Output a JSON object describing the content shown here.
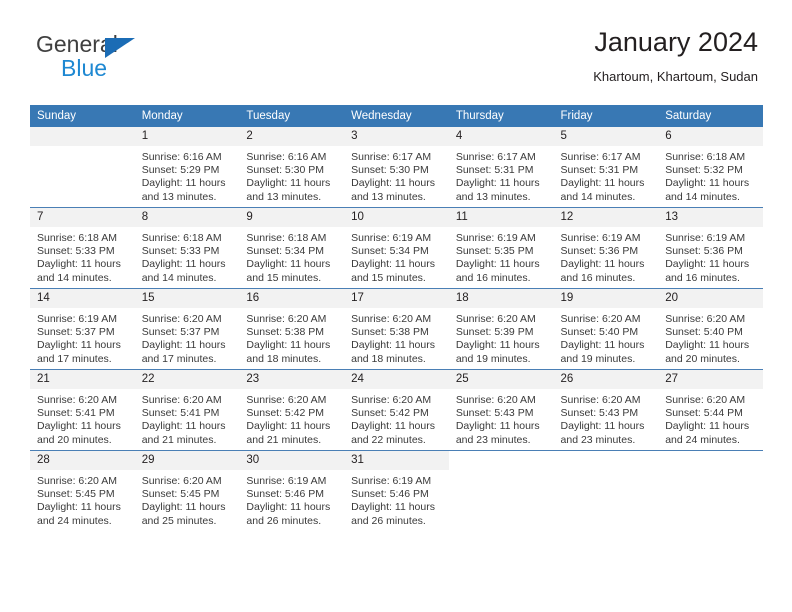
{
  "brand": {
    "name_top": "General",
    "name_bottom": "Blue",
    "triangle_color": "#1b6cb5",
    "blue_text_color": "#1e88d2"
  },
  "header": {
    "title": "January 2024",
    "location": "Khartoum, Khartoum, Sudan"
  },
  "theme": {
    "header_bar": "#3878b4",
    "daynum_band": "#f2f2f2",
    "row_divider": "#4a7fb5",
    "text": "#231f20"
  },
  "weekday_headers": [
    "Sunday",
    "Monday",
    "Tuesday",
    "Wednesday",
    "Thursday",
    "Friday",
    "Saturday"
  ],
  "labels": {
    "sunrise_prefix": "Sunrise:",
    "sunset_prefix": "Sunset:",
    "daylight_prefix": "Daylight:"
  },
  "weeks": [
    [
      {
        "day": "",
        "empty": true,
        "sunrise": "",
        "sunset": "",
        "daylight_line1": "",
        "daylight_line2": ""
      },
      {
        "day": "1",
        "sunrise": "Sunrise: 6:16 AM",
        "sunset": "Sunset: 5:29 PM",
        "daylight_line1": "Daylight: 11 hours",
        "daylight_line2": "and 13 minutes."
      },
      {
        "day": "2",
        "sunrise": "Sunrise: 6:16 AM",
        "sunset": "Sunset: 5:30 PM",
        "daylight_line1": "Daylight: 11 hours",
        "daylight_line2": "and 13 minutes."
      },
      {
        "day": "3",
        "sunrise": "Sunrise: 6:17 AM",
        "sunset": "Sunset: 5:30 PM",
        "daylight_line1": "Daylight: 11 hours",
        "daylight_line2": "and 13 minutes."
      },
      {
        "day": "4",
        "sunrise": "Sunrise: 6:17 AM",
        "sunset": "Sunset: 5:31 PM",
        "daylight_line1": "Daylight: 11 hours",
        "daylight_line2": "and 13 minutes."
      },
      {
        "day": "5",
        "sunrise": "Sunrise: 6:17 AM",
        "sunset": "Sunset: 5:31 PM",
        "daylight_line1": "Daylight: 11 hours",
        "daylight_line2": "and 14 minutes."
      },
      {
        "day": "6",
        "sunrise": "Sunrise: 6:18 AM",
        "sunset": "Sunset: 5:32 PM",
        "daylight_line1": "Daylight: 11 hours",
        "daylight_line2": "and 14 minutes."
      }
    ],
    [
      {
        "day": "7",
        "sunrise": "Sunrise: 6:18 AM",
        "sunset": "Sunset: 5:33 PM",
        "daylight_line1": "Daylight: 11 hours",
        "daylight_line2": "and 14 minutes."
      },
      {
        "day": "8",
        "sunrise": "Sunrise: 6:18 AM",
        "sunset": "Sunset: 5:33 PM",
        "daylight_line1": "Daylight: 11 hours",
        "daylight_line2": "and 14 minutes."
      },
      {
        "day": "9",
        "sunrise": "Sunrise: 6:18 AM",
        "sunset": "Sunset: 5:34 PM",
        "daylight_line1": "Daylight: 11 hours",
        "daylight_line2": "and 15 minutes."
      },
      {
        "day": "10",
        "sunrise": "Sunrise: 6:19 AM",
        "sunset": "Sunset: 5:34 PM",
        "daylight_line1": "Daylight: 11 hours",
        "daylight_line2": "and 15 minutes."
      },
      {
        "day": "11",
        "sunrise": "Sunrise: 6:19 AM",
        "sunset": "Sunset: 5:35 PM",
        "daylight_line1": "Daylight: 11 hours",
        "daylight_line2": "and 16 minutes."
      },
      {
        "day": "12",
        "sunrise": "Sunrise: 6:19 AM",
        "sunset": "Sunset: 5:36 PM",
        "daylight_line1": "Daylight: 11 hours",
        "daylight_line2": "and 16 minutes."
      },
      {
        "day": "13",
        "sunrise": "Sunrise: 6:19 AM",
        "sunset": "Sunset: 5:36 PM",
        "daylight_line1": "Daylight: 11 hours",
        "daylight_line2": "and 16 minutes."
      }
    ],
    [
      {
        "day": "14",
        "sunrise": "Sunrise: 6:19 AM",
        "sunset": "Sunset: 5:37 PM",
        "daylight_line1": "Daylight: 11 hours",
        "daylight_line2": "and 17 minutes."
      },
      {
        "day": "15",
        "sunrise": "Sunrise: 6:20 AM",
        "sunset": "Sunset: 5:37 PM",
        "daylight_line1": "Daylight: 11 hours",
        "daylight_line2": "and 17 minutes."
      },
      {
        "day": "16",
        "sunrise": "Sunrise: 6:20 AM",
        "sunset": "Sunset: 5:38 PM",
        "daylight_line1": "Daylight: 11 hours",
        "daylight_line2": "and 18 minutes."
      },
      {
        "day": "17",
        "sunrise": "Sunrise: 6:20 AM",
        "sunset": "Sunset: 5:38 PM",
        "daylight_line1": "Daylight: 11 hours",
        "daylight_line2": "and 18 minutes."
      },
      {
        "day": "18",
        "sunrise": "Sunrise: 6:20 AM",
        "sunset": "Sunset: 5:39 PM",
        "daylight_line1": "Daylight: 11 hours",
        "daylight_line2": "and 19 minutes."
      },
      {
        "day": "19",
        "sunrise": "Sunrise: 6:20 AM",
        "sunset": "Sunset: 5:40 PM",
        "daylight_line1": "Daylight: 11 hours",
        "daylight_line2": "and 19 minutes."
      },
      {
        "day": "20",
        "sunrise": "Sunrise: 6:20 AM",
        "sunset": "Sunset: 5:40 PM",
        "daylight_line1": "Daylight: 11 hours",
        "daylight_line2": "and 20 minutes."
      }
    ],
    [
      {
        "day": "21",
        "sunrise": "Sunrise: 6:20 AM",
        "sunset": "Sunset: 5:41 PM",
        "daylight_line1": "Daylight: 11 hours",
        "daylight_line2": "and 20 minutes."
      },
      {
        "day": "22",
        "sunrise": "Sunrise: 6:20 AM",
        "sunset": "Sunset: 5:41 PM",
        "daylight_line1": "Daylight: 11 hours",
        "daylight_line2": "and 21 minutes."
      },
      {
        "day": "23",
        "sunrise": "Sunrise: 6:20 AM",
        "sunset": "Sunset: 5:42 PM",
        "daylight_line1": "Daylight: 11 hours",
        "daylight_line2": "and 21 minutes."
      },
      {
        "day": "24",
        "sunrise": "Sunrise: 6:20 AM",
        "sunset": "Sunset: 5:42 PM",
        "daylight_line1": "Daylight: 11 hours",
        "daylight_line2": "and 22 minutes."
      },
      {
        "day": "25",
        "sunrise": "Sunrise: 6:20 AM",
        "sunset": "Sunset: 5:43 PM",
        "daylight_line1": "Daylight: 11 hours",
        "daylight_line2": "and 23 minutes."
      },
      {
        "day": "26",
        "sunrise": "Sunrise: 6:20 AM",
        "sunset": "Sunset: 5:43 PM",
        "daylight_line1": "Daylight: 11 hours",
        "daylight_line2": "and 23 minutes."
      },
      {
        "day": "27",
        "sunrise": "Sunrise: 6:20 AM",
        "sunset": "Sunset: 5:44 PM",
        "daylight_line1": "Daylight: 11 hours",
        "daylight_line2": "and 24 minutes."
      }
    ],
    [
      {
        "day": "28",
        "sunrise": "Sunrise: 6:20 AM",
        "sunset": "Sunset: 5:45 PM",
        "daylight_line1": "Daylight: 11 hours",
        "daylight_line2": "and 24 minutes."
      },
      {
        "day": "29",
        "sunrise": "Sunrise: 6:20 AM",
        "sunset": "Sunset: 5:45 PM",
        "daylight_line1": "Daylight: 11 hours",
        "daylight_line2": "and 25 minutes."
      },
      {
        "day": "30",
        "sunrise": "Sunrise: 6:19 AM",
        "sunset": "Sunset: 5:46 PM",
        "daylight_line1": "Daylight: 11 hours",
        "daylight_line2": "and 26 minutes."
      },
      {
        "day": "31",
        "sunrise": "Sunrise: 6:19 AM",
        "sunset": "Sunset: 5:46 PM",
        "daylight_line1": "Daylight: 11 hours",
        "daylight_line2": "and 26 minutes."
      },
      {
        "day": "",
        "blank": true,
        "sunrise": "",
        "sunset": "",
        "daylight_line1": "",
        "daylight_line2": ""
      },
      {
        "day": "",
        "blank": true,
        "sunrise": "",
        "sunset": "",
        "daylight_line1": "",
        "daylight_line2": ""
      },
      {
        "day": "",
        "blank": true,
        "sunrise": "",
        "sunset": "",
        "daylight_line1": "",
        "daylight_line2": ""
      }
    ]
  ]
}
